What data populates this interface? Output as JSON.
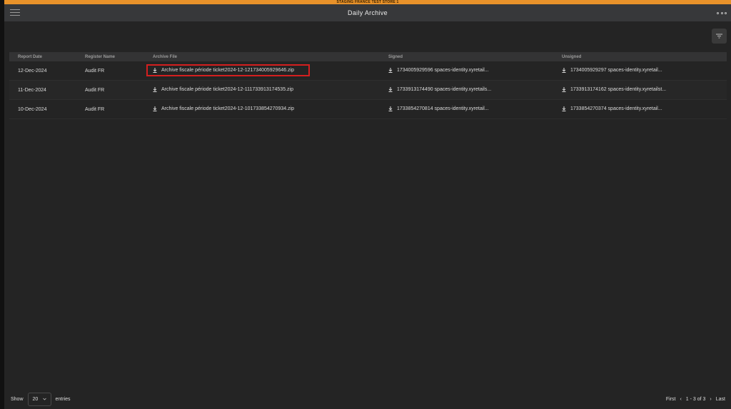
{
  "banner": {
    "text": "STAGING FRANCE TEST STORE 1"
  },
  "header": {
    "title": "Daily Archive",
    "menu_icon": "hamburger-icon",
    "more_icon": "more-dots-icon"
  },
  "toolbar": {
    "filter_icon": "filter-icon"
  },
  "table": {
    "columns": [
      "Report Date",
      "Register Name",
      "Archive File",
      "Signed",
      "Unsigned"
    ],
    "rows": [
      {
        "date": "12-Dec-2024",
        "register": "Audit FR",
        "archive": "Archive fiscale période ticket2024-12-121734005929646.zip",
        "signed": "1734005929596 spaces-identity.xyretail...",
        "unsigned": "1734005929297 spaces-identity.xyretail..."
      },
      {
        "date": "11-Dec-2024",
        "register": "Audit FR",
        "archive": "Archive fiscale période ticket2024-12-111733913174535.zip",
        "signed": "1733913174490 spaces-identity.xyretails...",
        "unsigned": "1733913174162 spaces-identity.xyretailst..."
      },
      {
        "date": "10-Dec-2024",
        "register": "Audit FR",
        "archive": "Archive fiscale période ticket2024-12-101733854270934.zip",
        "signed": "1733854270814 spaces-identity.xyretail...",
        "unsigned": "1733854270374 spaces-identity.xyretail..."
      }
    ]
  },
  "footer": {
    "show_label": "Show",
    "page_size": "20",
    "entries_label": "entries",
    "first_label": "First",
    "range_label": "1 - 3 of 3",
    "last_label": "Last"
  },
  "colors": {
    "banner": "#e8922a",
    "highlight": "#d41f1f",
    "background": "#242424"
  }
}
